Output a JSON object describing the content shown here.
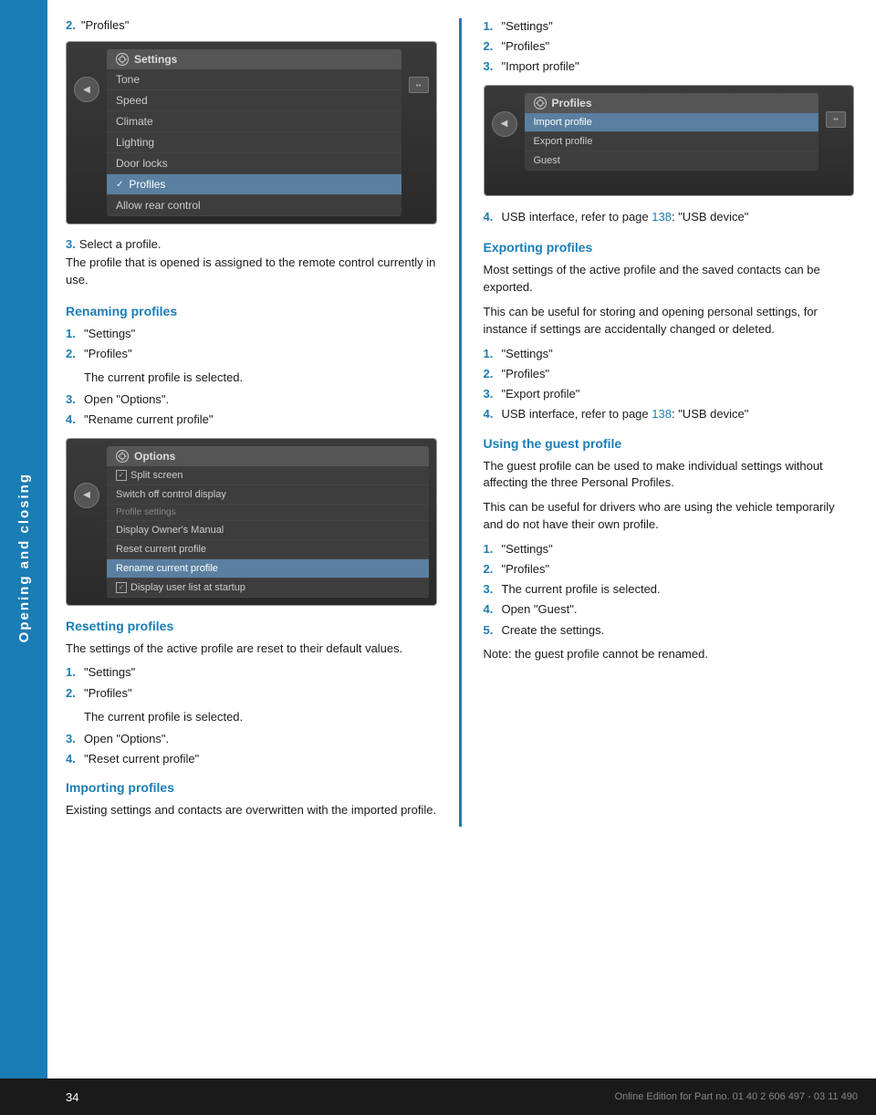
{
  "sidebar": {
    "label": "Opening and closing"
  },
  "footer": {
    "page_number": "34",
    "edition_text": "Online Edition for Part no. 01 40 2 606 497 - 03 11 490"
  },
  "left_col": {
    "step2_label": "2.",
    "step2_text": "\"Profiles\"",
    "step3_label": "3.",
    "step3_text": "Select a profile.",
    "body1": "The profile that is opened is assigned to the remote control currently in use.",
    "settings_screen": {
      "header": "Settings",
      "items": [
        "Tone",
        "Speed",
        "Climate",
        "Lighting",
        "Door locks",
        "Profiles",
        "Allow rear control"
      ],
      "highlighted_index": 5
    },
    "renaming_heading": "Renaming profiles",
    "renaming_steps": [
      {
        "num": "1.",
        "text": "\"Settings\""
      },
      {
        "num": "2.",
        "text": "\"Profiles\""
      },
      {
        "sub": "The current profile is selected."
      },
      {
        "num": "3.",
        "text": "Open \"Options\"."
      },
      {
        "num": "4.",
        "text": "\"Rename current profile\""
      }
    ],
    "options_screen": {
      "header": "Options",
      "items": [
        {
          "type": "check",
          "text": "Split screen"
        },
        {
          "type": "plain",
          "text": "Switch off control display"
        },
        {
          "type": "section",
          "text": "Profile settings"
        },
        {
          "type": "plain",
          "text": "Display Owner's Manual"
        },
        {
          "type": "plain",
          "text": "Reset current profile"
        },
        {
          "type": "highlight",
          "text": "Rename current profile"
        },
        {
          "type": "check",
          "text": "Display user list at startup"
        }
      ]
    },
    "resetting_heading": "Resetting profiles",
    "resetting_body": "The settings of the active profile are reset to their default values.",
    "resetting_steps": [
      {
        "num": "1.",
        "text": "\"Settings\""
      },
      {
        "num": "2.",
        "text": "\"Profiles\""
      },
      {
        "sub": "The current profile is selected."
      },
      {
        "num": "3.",
        "text": "Open \"Options\"."
      },
      {
        "num": "4.",
        "text": "\"Reset current profile\""
      }
    ],
    "importing_heading": "Importing profiles",
    "importing_body": "Existing settings and contacts are overwritten with the imported profile."
  },
  "right_col": {
    "import_steps_pre": [
      {
        "num": "1.",
        "text": "\"Settings\""
      },
      {
        "num": "2.",
        "text": "\"Profiles\""
      },
      {
        "num": "3.",
        "text": "\"Import profile\""
      }
    ],
    "profiles_screen": {
      "header": "Profiles",
      "items": [
        "Import profile",
        "Export profile",
        "Guest"
      ],
      "highlighted_index": 0
    },
    "step4_label": "4.",
    "step4_text": "USB interface, refer to page ",
    "step4_ref": "138",
    "step4_suffix": ": \"USB device\"",
    "exporting_heading": "Exporting profiles",
    "exporting_body1": "Most settings of the active profile and the saved contacts can be exported.",
    "exporting_body2": "This can be useful for storing and opening personal settings, for instance if settings are accidentally changed or deleted.",
    "exporting_steps": [
      {
        "num": "1.",
        "text": "\"Settings\""
      },
      {
        "num": "2.",
        "text": "\"Profiles\""
      },
      {
        "num": "3.",
        "text": "\"Export profile\""
      },
      {
        "num": "4.",
        "text": "USB interface, refer to page ",
        "ref": "138",
        "suffix": ": \"USB device\""
      }
    ],
    "guest_heading": "Using the guest profile",
    "guest_body1": "The guest profile can be used to make individual settings without affecting the three Personal Profiles.",
    "guest_body2": "This can be useful for drivers who are using the vehicle temporarily and do not have their own profile.",
    "guest_steps": [
      {
        "num": "1.",
        "text": "\"Settings\""
      },
      {
        "num": "2.",
        "text": "\"Profiles\""
      },
      {
        "num": "3.",
        "text": "The current profile is selected."
      },
      {
        "num": "4.",
        "text": "Open \"Guest\"."
      },
      {
        "num": "5.",
        "text": "Create the settings."
      }
    ],
    "guest_note": "Note: the guest profile cannot be renamed."
  }
}
